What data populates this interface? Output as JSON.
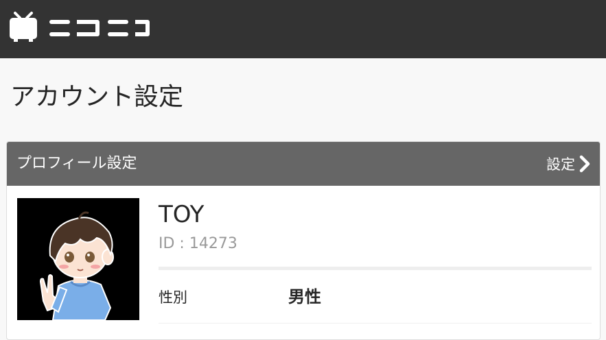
{
  "header": {
    "logo_icon": "tv-icon",
    "brand_color": "#333333"
  },
  "page": {
    "title": "アカウント設定"
  },
  "profile_card": {
    "title": "プロフィール設定",
    "settings_link_label": "設定",
    "settings_link_icon": "chevron-right-icon",
    "header_color": "#666666",
    "user": {
      "name": "TOY",
      "id_text": "ID : 14273"
    },
    "fields": [
      {
        "label": "性別",
        "value": "男性"
      }
    ]
  }
}
